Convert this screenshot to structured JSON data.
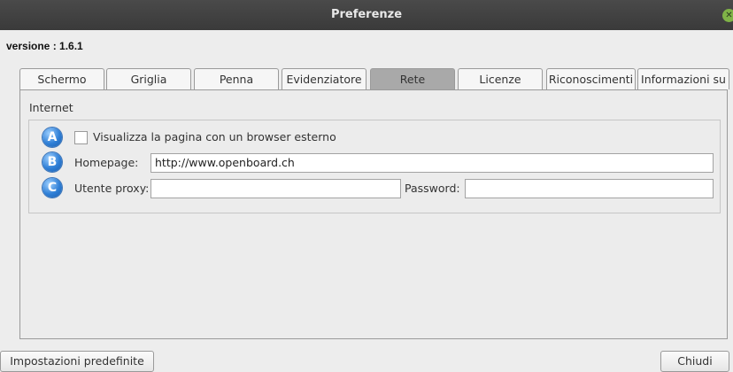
{
  "window": {
    "title": "Preferenze",
    "close_icon": "close-icon"
  },
  "version_label": "versione : 1.6.1",
  "tabs": [
    {
      "label": "Schermo",
      "active": false
    },
    {
      "label": "Griglia",
      "active": false
    },
    {
      "label": "Penna",
      "active": false
    },
    {
      "label": "Evidenziatore",
      "active": false
    },
    {
      "label": "Rete",
      "active": true
    },
    {
      "label": "Licenze",
      "active": false
    },
    {
      "label": "Riconoscimenti",
      "active": false
    },
    {
      "label": "Informazioni su",
      "active": false
    }
  ],
  "internet": {
    "group_title": "Internet",
    "badges": [
      "A",
      "B",
      "C"
    ],
    "external_browser": {
      "label": "Visualizza la pagina con un browser esterno",
      "checked": false
    },
    "homepage": {
      "label": "Homepage:",
      "value": "http://www.openboard.ch"
    },
    "proxy_user": {
      "label": "Utente proxy:",
      "value": ""
    },
    "password": {
      "label": "Password:",
      "value": ""
    }
  },
  "buttons": {
    "defaults": "Impostazioni predefinite",
    "close": "Chiudi"
  },
  "colors": {
    "titlebar": "#3f3f3f",
    "close": "#7fb347",
    "active_tab": "#a9a9a9",
    "badge": "#2f7fd6"
  }
}
